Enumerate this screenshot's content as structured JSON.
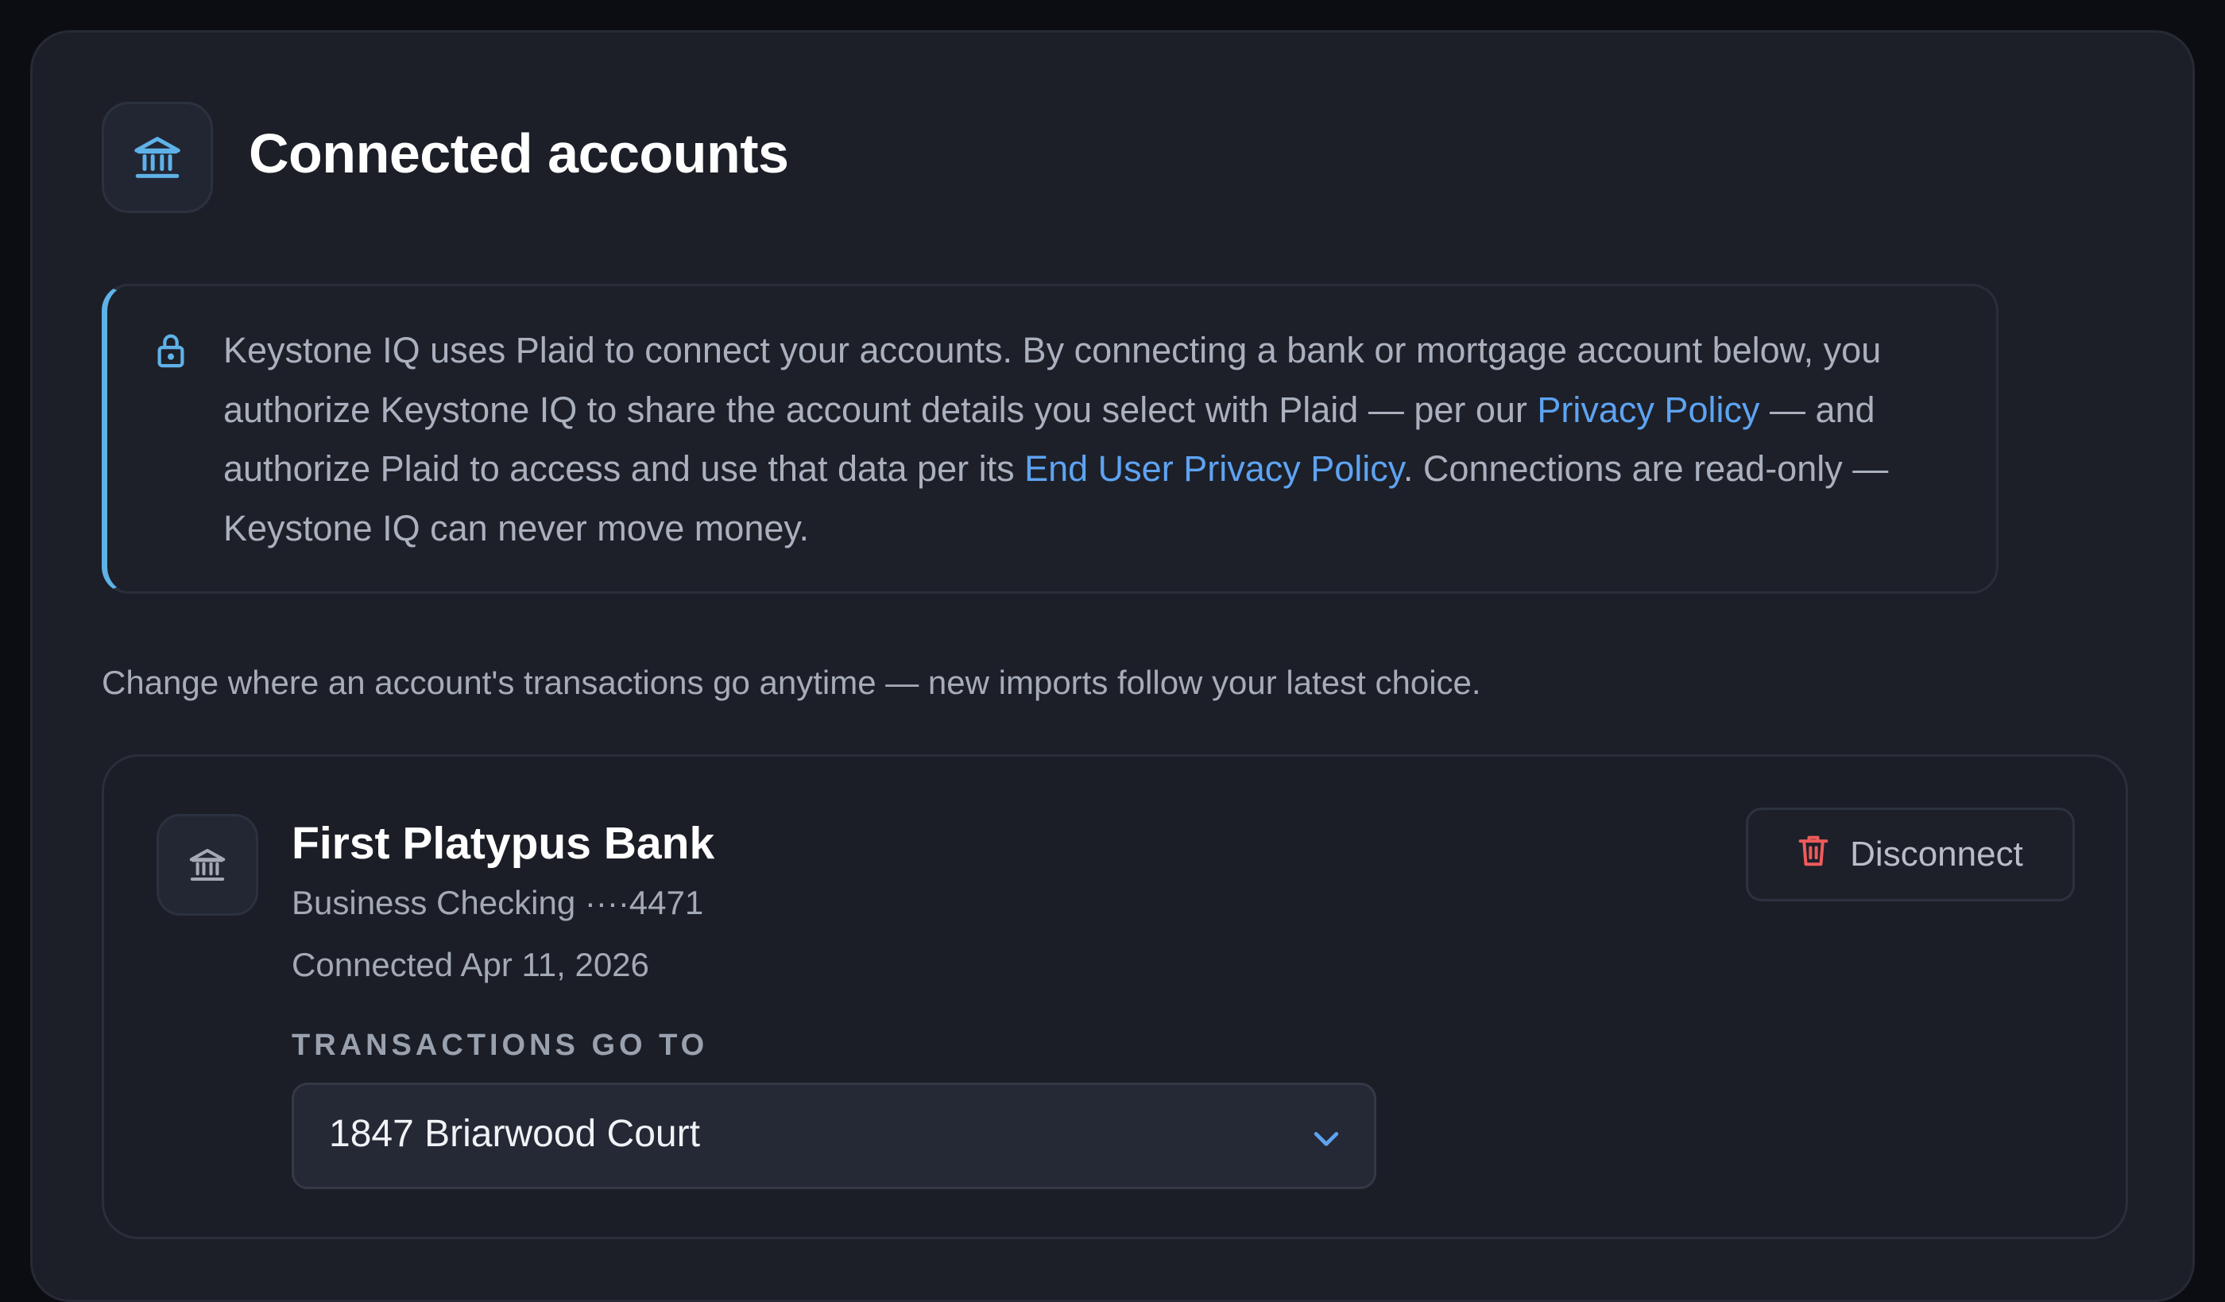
{
  "header": {
    "title": "Connected accounts",
    "icon": "bank-icon"
  },
  "notice": {
    "icon": "lock-icon",
    "line1": "Keystone IQ uses Plaid to connect your accounts. By connecting a bank or mortgage account below, you authorize Keystone IQ to share the account details you select with Plaid — per our ",
    "privacy_link": "Privacy Policy",
    "line2": " — and authorize Plaid to access and use that data per its ",
    "end_user_link": "End User Privacy Policy",
    "line3": ". Connections are read-only — Keystone IQ can never move money.",
    "accent_color": "#5fb2e8",
    "link_color": "#5ea3f2"
  },
  "subtext": "Change where an account's transactions go anytime — new imports follow your latest choice.",
  "accounts": [
    {
      "icon": "bank-icon",
      "name": "First Platypus Bank",
      "account": "Business Checking ····4471",
      "connected": "Connected Apr 11, 2026",
      "disconnect_label": "Disconnect",
      "disconnect_icon": "trash-icon",
      "field_label": "TRANSACTIONS GO TO",
      "destination": "1847 Briarwood Court"
    }
  ]
}
